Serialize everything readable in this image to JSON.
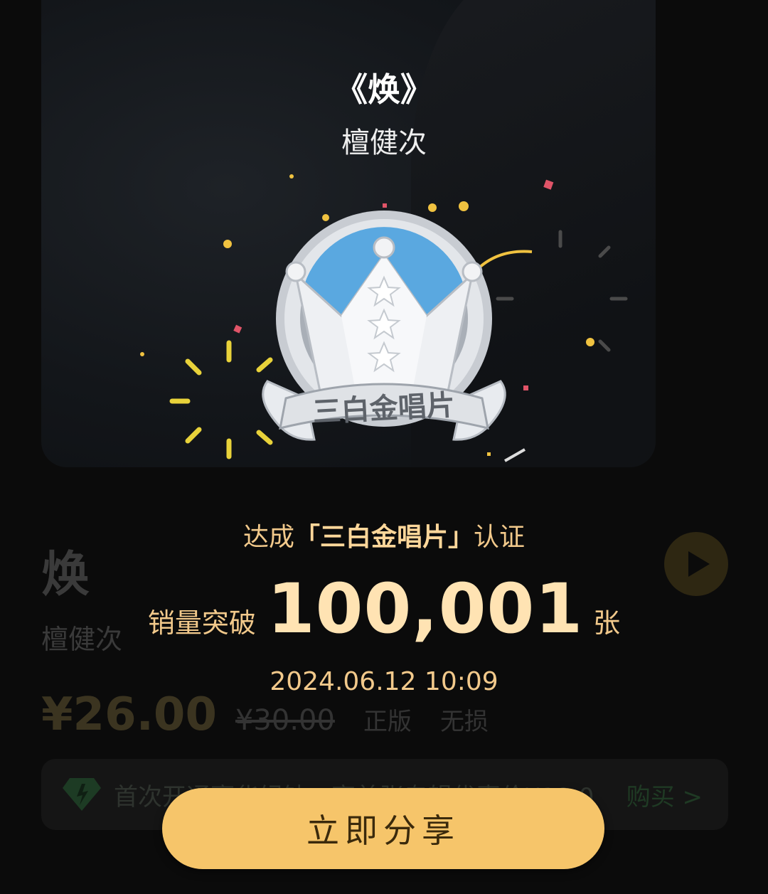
{
  "background": {
    "song_title": "焕",
    "artist": "檀健次",
    "price_now": "¥26.00",
    "price_old": "¥30.00",
    "tags": [
      "正版",
      "无损"
    ],
    "vip_banner_text": "首次开通豪华绿钻，享首张专辑优惠价¥10.0",
    "vip_buy_label": "购买 >"
  },
  "overlay": {
    "album_title": "《焕》",
    "artist": "檀健次",
    "badge_label": "三白金唱片",
    "achieve_prefix": "达成",
    "achieve_highlight": "「三白金唱片」",
    "achieve_suffix": "认证",
    "sales_prefix": "销量突破",
    "sales_number": "100,001",
    "sales_unit": "张",
    "date": "2024.06.12 10:09",
    "share_label": "立即分享"
  },
  "colors": {
    "accent": "#f6c56a",
    "gold_text": "#f2c98b",
    "badge_blue": "#5aa8e0",
    "badge_silver": "#d9dde2"
  }
}
